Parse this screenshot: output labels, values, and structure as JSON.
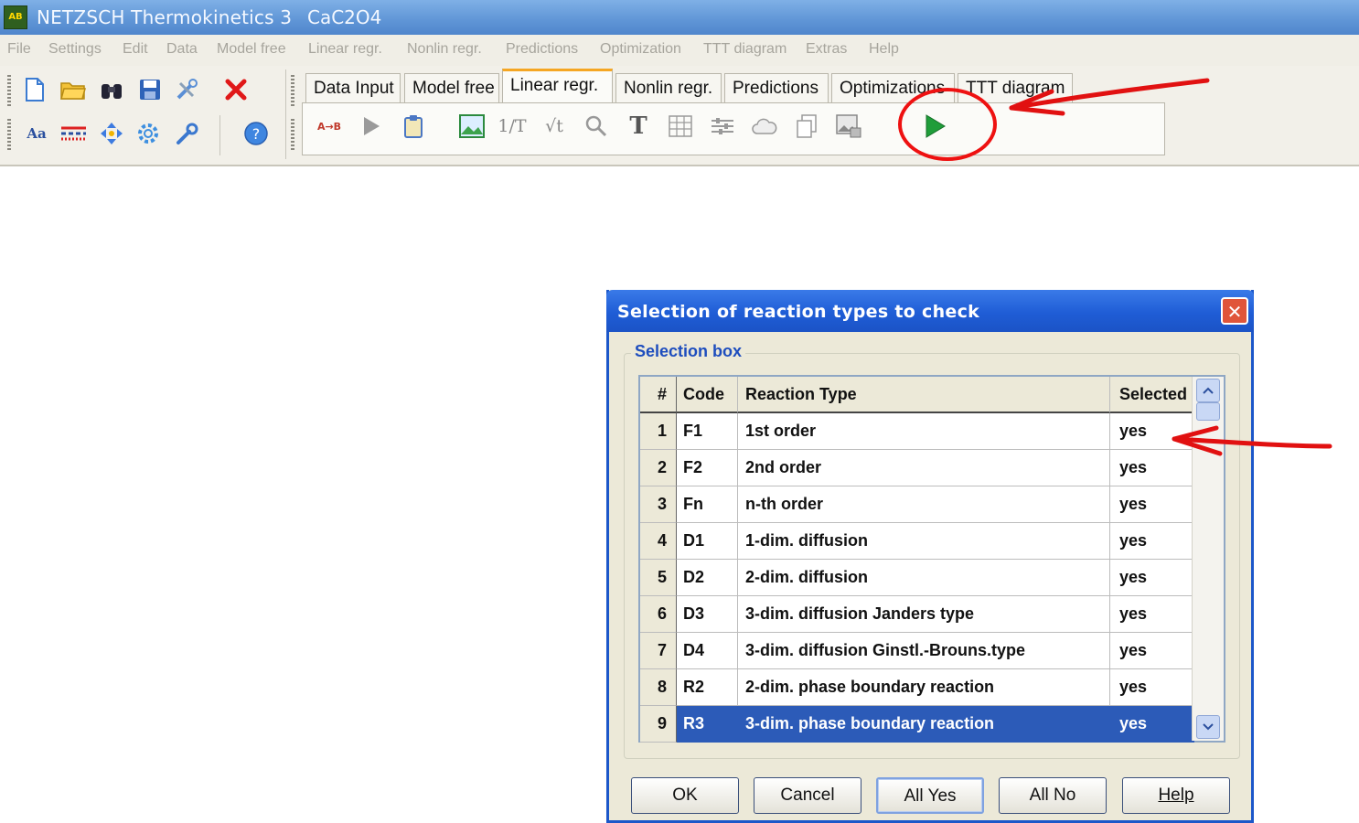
{
  "window": {
    "app_title": "NETZSCH Thermokinetics 3",
    "file_name": "CaC2O4",
    "app_icon_text": "AB"
  },
  "menu": [
    "File",
    "Settings",
    "Edit",
    "Data",
    "Model free",
    "Linear regr.",
    "Nonlin regr.",
    "Predictions",
    "Optimization",
    "TTT diagram",
    "Extras",
    "Help"
  ],
  "toolbar": {
    "row1_icons": [
      "new-file-icon",
      "open-folder-icon",
      "binoculars-icon",
      "save-icon",
      "tools-icon",
      "delete-icon"
    ],
    "row2_icons": [
      "font-icon",
      "line-style-icon",
      "move-icon",
      "settings-gear-icon",
      "wrench-icon",
      "help-icon"
    ]
  },
  "tabs": [
    {
      "label": "Data Input",
      "active": false
    },
    {
      "label": "Model free",
      "active": false
    },
    {
      "label": "Linear regr.",
      "active": true
    },
    {
      "label": "Nonlin regr.",
      "active": false
    },
    {
      "label": "Predictions",
      "active": false
    },
    {
      "label": "Optimizations",
      "active": false
    },
    {
      "label": "TTT diagram",
      "active": false
    }
  ],
  "tab_panel_icons": [
    "a-to-b-icon",
    "play-gray-icon",
    "clipboard-icon",
    "chart-image-icon",
    "inverse-t-icon",
    "sqrt-t-icon",
    "zoom-icon",
    "text-icon",
    "table-icon",
    "sliders-icon",
    "cloud-icon",
    "copy-icon",
    "export-image-icon",
    "run-icon"
  ],
  "tab_panel_text": {
    "a_to_b": "A→B",
    "inv_t": "1/T",
    "sqrt_t": "√t",
    "text_t": "T"
  },
  "dialog": {
    "title": "Selection of reaction types to check",
    "close_glyph": "✕",
    "group_label": "Selection box",
    "columns": [
      "#",
      "Code",
      "Reaction Type",
      "Selected"
    ],
    "rows": [
      {
        "num": "1",
        "code": "F1",
        "type": "1st order",
        "selected": "yes"
      },
      {
        "num": "2",
        "code": "F2",
        "type": "2nd order",
        "selected": "yes"
      },
      {
        "num": "3",
        "code": "Fn",
        "type": "n-th order",
        "selected": "yes"
      },
      {
        "num": "4",
        "code": "D1",
        "type": "1-dim. diffusion",
        "selected": "yes"
      },
      {
        "num": "5",
        "code": "D2",
        "type": "2-dim. diffusion",
        "selected": "yes"
      },
      {
        "num": "6",
        "code": "D3",
        "type": "3-dim. diffusion Janders type",
        "selected": "yes"
      },
      {
        "num": "7",
        "code": "D4",
        "type": "3-dim. diffusion Ginstl.-Brouns.type",
        "selected": "yes"
      },
      {
        "num": "8",
        "code": "R2",
        "type": "2-dim. phase boundary reaction",
        "selected": "yes"
      },
      {
        "num": "9",
        "code": "R3",
        "type": "3-dim. phase boundary reaction",
        "selected": "yes"
      }
    ],
    "selected_row": "9",
    "buttons": {
      "ok": "OK",
      "cancel": "Cancel",
      "all_yes": "All Yes",
      "all_no": "All No",
      "help": "Help"
    }
  },
  "colors": {
    "annotation_red": "#e11111",
    "selection_blue": "#2c5bb8",
    "dialog_title_blue": "#1f5dd6",
    "active_tab_accent": "#f5a623"
  }
}
